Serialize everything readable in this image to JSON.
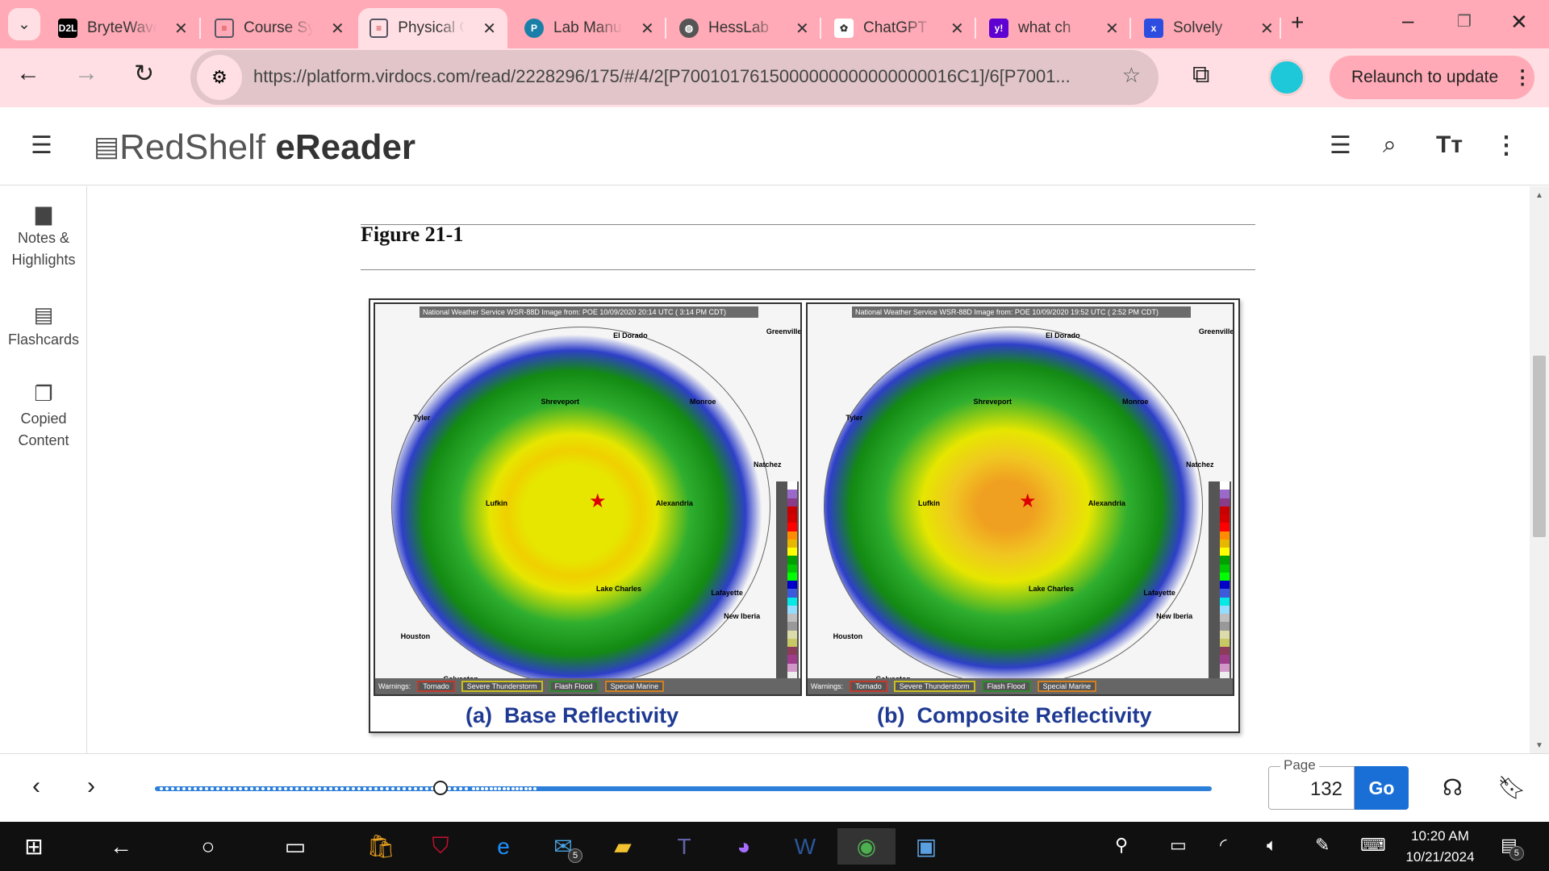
{
  "browser": {
    "tabs": [
      {
        "title": "BryteWave",
        "favicon": "D2L",
        "color": "#000000"
      },
      {
        "title": "Course Syllabus",
        "favicon": "doc-icon",
        "color": "#ffffff"
      },
      {
        "title": "Physical Geography",
        "favicon": "doc-icon",
        "color": "#ffffff",
        "active": true
      },
      {
        "title": "Lab Manual",
        "favicon": "P",
        "color": "#1a7fa8"
      },
      {
        "title": "HessLab",
        "favicon": "globe-icon",
        "color": "#555555"
      },
      {
        "title": "ChatGPT",
        "favicon": "openai-icon",
        "color": "#ffffff"
      },
      {
        "title": "what ch",
        "favicon": "y!",
        "color": "#5f01d1"
      },
      {
        "title": "Solvely",
        "favicon": "x",
        "color": "#2d4de0"
      }
    ],
    "url": "https://platform.virdocs.com/read/2228296/175/#/4/2[P7001017615000000000000000016C1]/6[P7001...",
    "relaunch_label": "Relaunch to update"
  },
  "app": {
    "logo_light": "RedShelf",
    "logo_bold": "eReader"
  },
  "sidebar": {
    "items": [
      {
        "label": "Notes & Highlights"
      },
      {
        "label": "Flashcards"
      },
      {
        "label": "Copied Content"
      }
    ]
  },
  "figure": {
    "title": "Figure 21-1",
    "panels": [
      {
        "header": "National Weather Service WSR-88D Image from: POE 10/09/2020 20:14 UTC ( 3:14 PM CDT)",
        "caption_tag": "(a)",
        "caption": "Base Reflectivity"
      },
      {
        "header": "National Weather Service WSR-88D Image from: POE 10/09/2020 19:52 UTC ( 2:52 PM CDT)",
        "caption_tag": "(b)",
        "caption": "Composite Reflectivity"
      }
    ],
    "warnings_label": "Warnings:",
    "warnings": [
      {
        "label": "Tornado",
        "color": "#c0392b"
      },
      {
        "label": "Severe Thunderstorm",
        "color": "#c8c020"
      },
      {
        "label": "Flash Flood",
        "color": "#2e8b2e"
      },
      {
        "label": "Special Marine",
        "color": "#d08020"
      }
    ],
    "cities": [
      "El Dorado",
      "Greenville",
      "Tyler",
      "Shreveport",
      "Monroe",
      "Natchez",
      "Lufkin",
      "Alexandria",
      "Lake Charles",
      "Lafayette",
      "New Iberia",
      "Houston",
      "Galveston"
    ]
  },
  "reader": {
    "page_label": "Page",
    "page_value": "132",
    "go_label": "Go",
    "progress": 0.27
  },
  "taskbar": {
    "time": "10:20 AM",
    "date": "10/21/2024",
    "mail_badge": "5",
    "notif_badge": "5"
  }
}
